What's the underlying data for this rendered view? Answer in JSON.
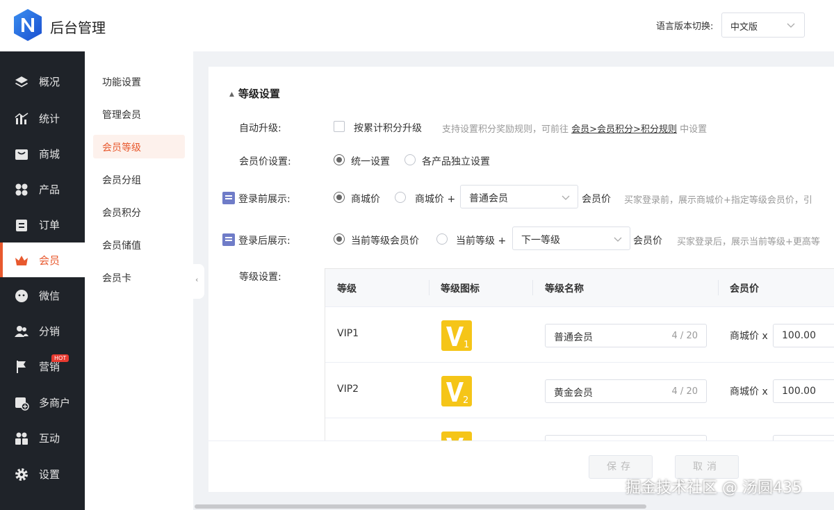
{
  "header": {
    "app_title": "后台管理",
    "lang_label": "语言版本切换:",
    "lang_value": "中文版"
  },
  "sidebar": {
    "items": [
      {
        "label": "概况",
        "icon": "layers-icon"
      },
      {
        "label": "统计",
        "icon": "chart-icon"
      },
      {
        "label": "商城",
        "icon": "shop-icon"
      },
      {
        "label": "产品",
        "icon": "grid-icon"
      },
      {
        "label": "订单",
        "icon": "clipboard-icon"
      },
      {
        "label": "会员",
        "icon": "crown-icon",
        "active": true
      },
      {
        "label": "微信",
        "icon": "wechat-icon"
      },
      {
        "label": "分销",
        "icon": "users-icon"
      },
      {
        "label": "营销",
        "icon": "flag-icon",
        "badge": "HOT"
      },
      {
        "label": "多商户",
        "icon": "store-add-icon"
      },
      {
        "label": "互动",
        "icon": "group-icon"
      },
      {
        "label": "设置",
        "icon": "gear-icon"
      }
    ]
  },
  "submenu": {
    "items": [
      {
        "label": "功能设置"
      },
      {
        "label": "管理会员"
      },
      {
        "label": "会员等级",
        "active": true
      },
      {
        "label": "会员分组"
      },
      {
        "label": "会员积分"
      },
      {
        "label": "会员储值"
      },
      {
        "label": "会员卡"
      }
    ]
  },
  "content": {
    "section_title": "等级设置",
    "auto_upgrade": {
      "label": "自动升级:",
      "checkbox_label": "按累计积分升级",
      "tip_prefix": "支持设置积分奖励规则，可前往",
      "tip_link": "会员>会员积分>积分规则",
      "tip_suffix": "中设置"
    },
    "member_price": {
      "label": "会员价设置:",
      "option_1": "统一设置",
      "option_2": "各产品独立设置"
    },
    "before_login": {
      "label": "登录前展示:",
      "option_1": "商城价",
      "option_2": "商城价 +",
      "select_value": "普通会员",
      "suffix": "会员价",
      "tip": "买家登录前，展示商城价+指定等级会员价，引"
    },
    "after_login": {
      "label": "登录后展示:",
      "option_1": "当前等级会员价",
      "option_2": "当前等级 +",
      "select_value": "下一等级",
      "suffix": "会员价",
      "tip": "买家登录后，展示当前等级+更高等"
    },
    "level_settings_label": "等级设置:",
    "table": {
      "headers": [
        "等级",
        "等级图标",
        "等级名称",
        "会员价"
      ],
      "rows": [
        {
          "level": "VIP1",
          "icon": "vip1-icon",
          "name": "普通会员",
          "count": "4 / 20",
          "price_label": "商城价 x",
          "price": "100.00"
        },
        {
          "level": "VIP2",
          "icon": "vip2-icon",
          "name": "黄金会员",
          "count": "4 / 20",
          "price_label": "商城价 x",
          "price": "100.00"
        }
      ]
    },
    "footer": {
      "save": "保存",
      "cancel": "取消"
    }
  },
  "watermark": "掘金技术社区 @ 汤圆435",
  "colors": {
    "accent": "#e8592e",
    "sidebar_bg": "#1f2329",
    "vip_gold": "#f5c518"
  }
}
